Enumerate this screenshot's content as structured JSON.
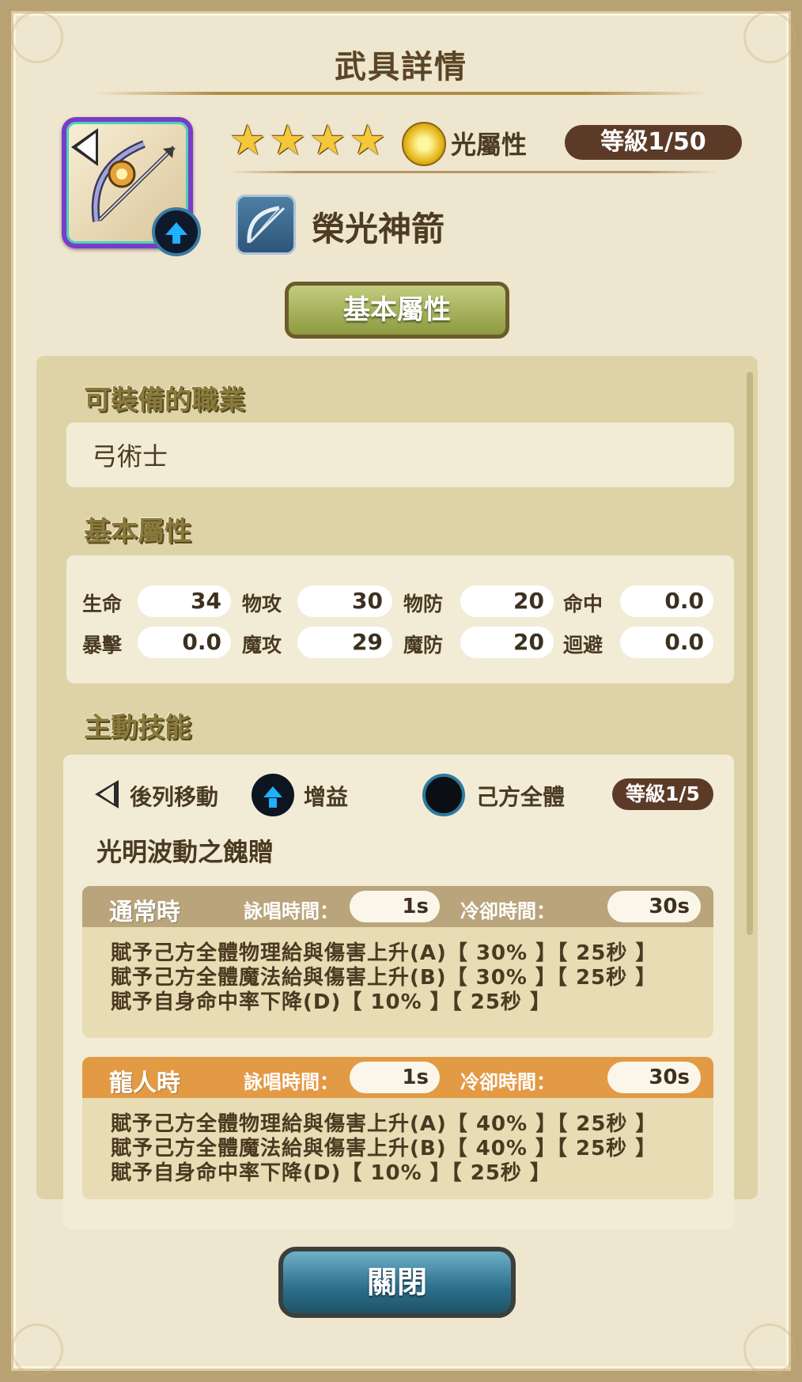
{
  "header": {
    "title": "武具詳情"
  },
  "weapon": {
    "icon": "bow-icon",
    "stars": 4,
    "element_label": "光屬性",
    "level": "等級1/50",
    "name": "榮光神箭",
    "type_icon": "bow-type-icon"
  },
  "tab": {
    "label": "基本屬性"
  },
  "sections": {
    "classes_title": "可裝備的職業",
    "classes_value": "弓術士",
    "stats_title": "基本屬性",
    "skill_title": "主動技能"
  },
  "stats": [
    {
      "label": "生命",
      "value": "34"
    },
    {
      "label": "物攻",
      "value": "30"
    },
    {
      "label": "物防",
      "value": "20"
    },
    {
      "label": "命中",
      "value": "0.0"
    },
    {
      "label": "暴擊",
      "value": "0.0"
    },
    {
      "label": "魔攻",
      "value": "29"
    },
    {
      "label": "魔防",
      "value": "20"
    },
    {
      "label": "迴避",
      "value": "0.0"
    }
  ],
  "skill": {
    "position": "後列移動",
    "effect": "增益",
    "target": "己方全體",
    "level": "等級1/5",
    "name": "光明波動之餽贈",
    "modes": [
      {
        "name": "通常時",
        "cast_label": "詠唱時間：",
        "cast_value": "1s",
        "cooldown_label": "冷卻時間：",
        "cooldown_value": "30s",
        "header_color": "#b9a47c",
        "lines": [
          "賦予己方全體物理給與傷害上升(A)【 30% 】【 25秒 】",
          "賦予己方全體魔法給與傷害上升(B)【 30% 】【 25秒 】",
          "賦予自身命中率下降(D)【 10% 】【 25秒 】"
        ]
      },
      {
        "name": "龍人時",
        "cast_label": "詠唱時間：",
        "cast_value": "1s",
        "cooldown_label": "冷卻時間：",
        "cooldown_value": "30s",
        "header_color": "#e39a45",
        "lines": [
          "賦予己方全體物理給與傷害上升(A)【 40% 】【 25秒 】",
          "賦予己方全體魔法給與傷害上升(B)【 40% 】【 25秒 】",
          "賦予自身命中率下降(D)【 10% 】【 25秒 】"
        ]
      }
    ]
  },
  "footer": {
    "close_label": "關閉"
  }
}
